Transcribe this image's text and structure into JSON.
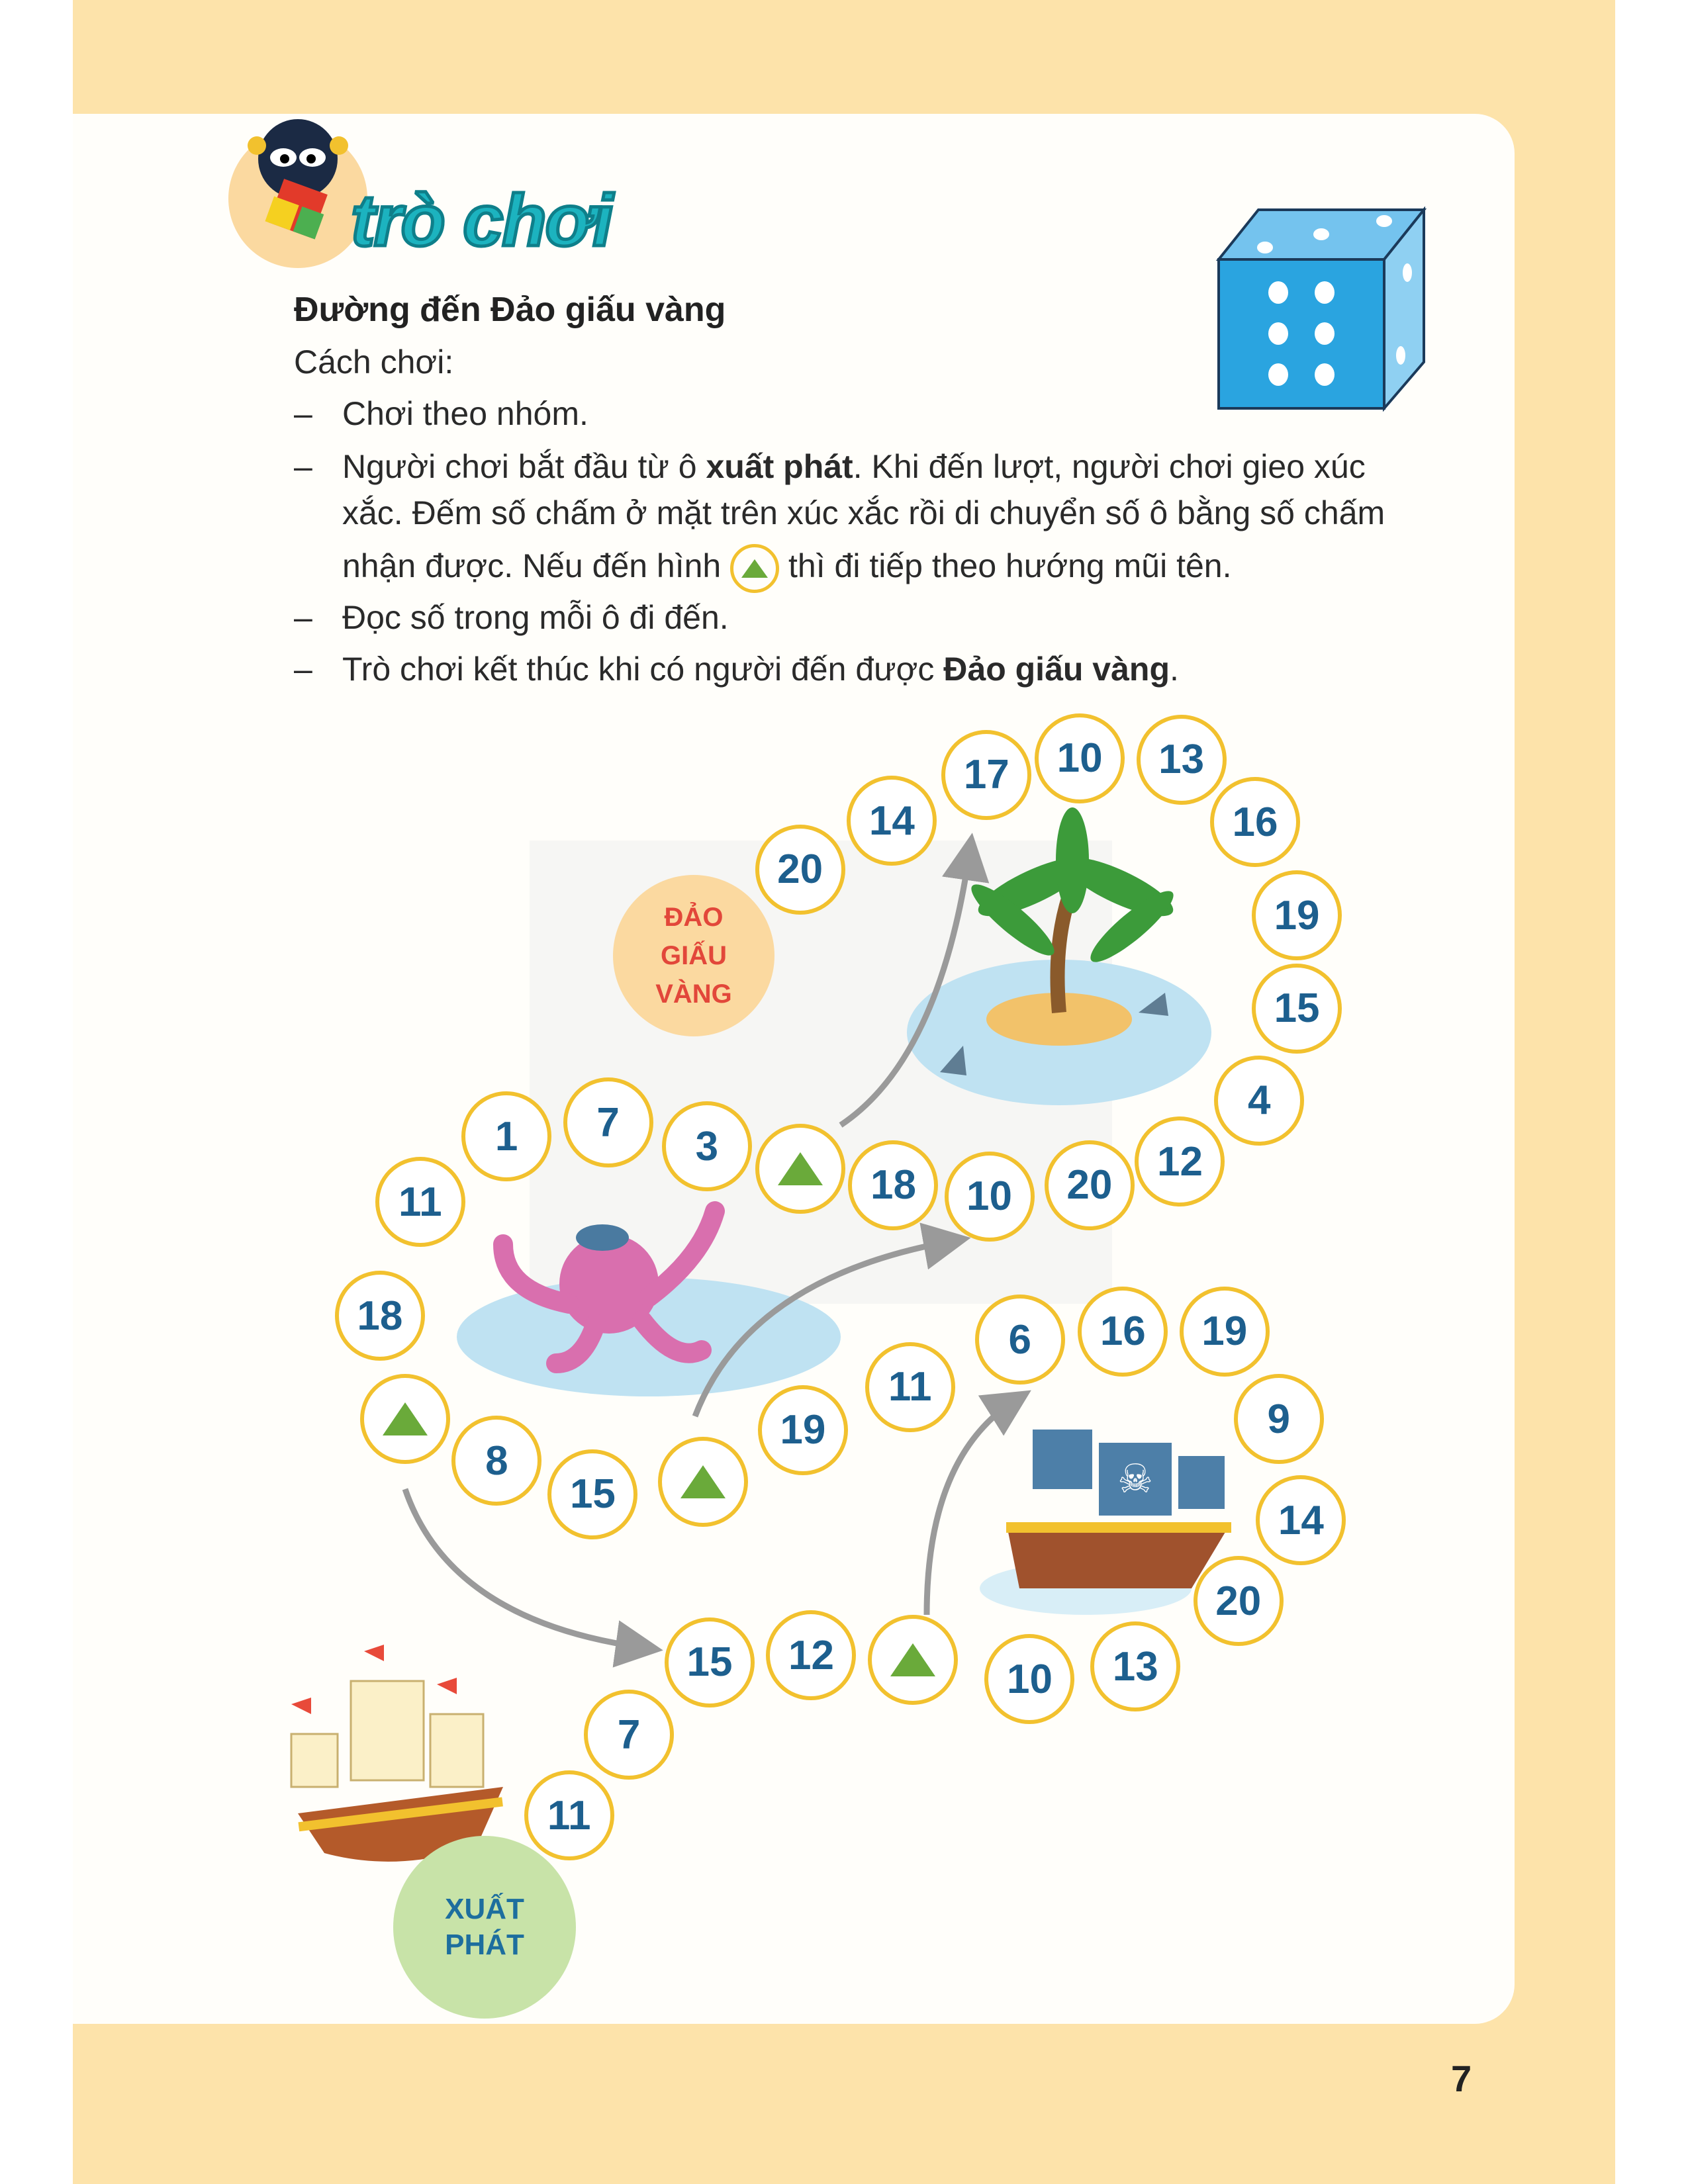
{
  "header": {
    "logo_text": "trò chơi"
  },
  "game": {
    "title": "Đường đến Đảo giấu vàng",
    "how_to_play": "Cách chơi:",
    "rules": [
      {
        "text": "Chơi theo nhóm."
      },
      {
        "pre": "Người chơi bắt đầu từ ô ",
        "bold": "xuất phát",
        "post": ". Khi đến lượt, người chơi gieo xúc",
        "line2": "xắc. Đếm số chấm ở mặt trên xúc xắc rồi di chuyển số ô bằng số chấm",
        "line3_pre": "nhận được. Nếu đến hình",
        "line3_post": "thì đi tiếp theo hướng mũi tên."
      },
      {
        "text": "Đọc số trong mỗi ô đi đến."
      },
      {
        "pre": "Trò chơi kết thúc khi có người đến được ",
        "bold": "Đảo giấu vàng",
        "post": "."
      }
    ],
    "dash": "–"
  },
  "board": {
    "start_label_1": "XUẤT",
    "start_label_2": "PHÁT",
    "goal_label_1": "ĐẢO",
    "goal_label_2": "GIẤU",
    "goal_label_3": "VÀNG",
    "cells": [
      "11",
      "7",
      "15",
      "12",
      "▲",
      "10",
      "13",
      "20",
      "14",
      "9",
      "19",
      "16",
      "6",
      "11",
      "19",
      "▲",
      "15",
      "8",
      "▲",
      "18",
      "11",
      "1",
      "7",
      "3",
      "▲",
      "18",
      "10",
      "20",
      "12",
      "4",
      "15",
      "19",
      "16",
      "13",
      "10",
      "17",
      "14",
      "20"
    ]
  },
  "colors": {
    "number": "#1d5f8e",
    "ring": "#f2c12e",
    "triangle": "#6aaa3a",
    "page_bg": "#fde3aa"
  },
  "footer": {
    "page_number": "7"
  }
}
